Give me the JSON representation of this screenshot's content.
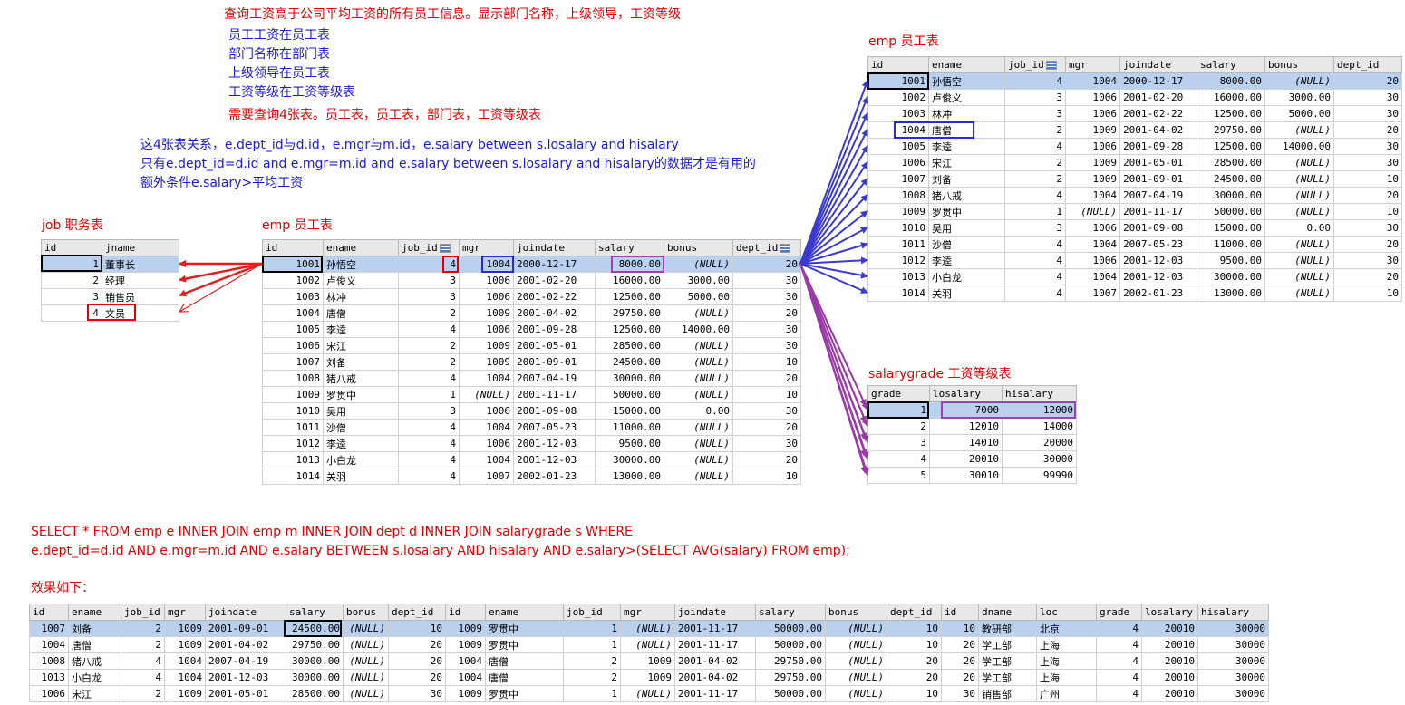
{
  "notes": {
    "line1": "查询工资高于公司平均工资的所有员工信息。显示部门名称，上级领导，工资等级",
    "line2": "员工工资在员工表",
    "line3": "部门名称在部门表",
    "line4": "上级领导在员工表",
    "line5": "工资等级在工资等级表",
    "line6": "需要查询4张表。员工表，员工表，部门表，工资等级表",
    "line7": "这4张表关系，e.dept_id与d.id，e.mgr与m.id，e.salary between s.losalary and hisalary",
    "line8": "只有e.dept_id=d.id and e.mgr=m.id and e.salary between s.losalary and hisalary的数据才是有用的",
    "line9": "额外条件e.salary>平均工资"
  },
  "titles": {
    "job": "job 职务表",
    "emp_mid": "emp 员工表",
    "emp_right": "emp 员工表",
    "salarygrade": "salarygrade 工资等级表",
    "result": "效果如下："
  },
  "sql": {
    "line1": "SELECT * FROM emp e INNER JOIN emp m INNER JOIN dept d INNER JOIN salarygrade s WHERE",
    "line2": "e.dept_id=d.id AND e.mgr=m.id AND e.salary BETWEEN s.losalary AND hisalary AND e.salary>(SELECT AVG(salary) FROM emp);"
  },
  "job_table": {
    "headers": [
      "id",
      "jname"
    ],
    "rows": [
      [
        "1",
        "董事长"
      ],
      [
        "2",
        "经理"
      ],
      [
        "3",
        "销售员"
      ],
      [
        "4",
        "文员"
      ]
    ]
  },
  "emp_table": {
    "headers": [
      "id",
      "ename",
      "job_id",
      "mgr",
      "joindate",
      "salary",
      "bonus",
      "dept_id"
    ],
    "rows": [
      [
        "1001",
        "孙悟空",
        "4",
        "1004",
        "2000-12-17",
        "8000.00",
        "(NULL)",
        "20"
      ],
      [
        "1002",
        "卢俊义",
        "3",
        "1006",
        "2001-02-20",
        "16000.00",
        "3000.00",
        "30"
      ],
      [
        "1003",
        "林冲",
        "3",
        "1006",
        "2001-02-22",
        "12500.00",
        "5000.00",
        "30"
      ],
      [
        "1004",
        "唐僧",
        "2",
        "1009",
        "2001-04-02",
        "29750.00",
        "(NULL)",
        "20"
      ],
      [
        "1005",
        "李逵",
        "4",
        "1006",
        "2001-09-28",
        "12500.00",
        "14000.00",
        "30"
      ],
      [
        "1006",
        "宋江",
        "2",
        "1009",
        "2001-05-01",
        "28500.00",
        "(NULL)",
        "30"
      ],
      [
        "1007",
        "刘备",
        "2",
        "1009",
        "2001-09-01",
        "24500.00",
        "(NULL)",
        "10"
      ],
      [
        "1008",
        "猪八戒",
        "4",
        "1004",
        "2007-04-19",
        "30000.00",
        "(NULL)",
        "20"
      ],
      [
        "1009",
        "罗贯中",
        "1",
        "(NULL)",
        "2001-11-17",
        "50000.00",
        "(NULL)",
        "10"
      ],
      [
        "1010",
        "吴用",
        "3",
        "1006",
        "2001-09-08",
        "15000.00",
        "0.00",
        "30"
      ],
      [
        "1011",
        "沙僧",
        "4",
        "1004",
        "2007-05-23",
        "11000.00",
        "(NULL)",
        "20"
      ],
      [
        "1012",
        "李逵",
        "4",
        "1006",
        "2001-12-03",
        "9500.00",
        "(NULL)",
        "30"
      ],
      [
        "1013",
        "小白龙",
        "4",
        "1004",
        "2001-12-03",
        "30000.00",
        "(NULL)",
        "20"
      ],
      [
        "1014",
        "关羽",
        "4",
        "1007",
        "2002-01-23",
        "13000.00",
        "(NULL)",
        "10"
      ]
    ]
  },
  "salarygrade_table": {
    "headers": [
      "grade",
      "losalary",
      "hisalary"
    ],
    "rows": [
      [
        "1",
        "7000",
        "12000"
      ],
      [
        "2",
        "12010",
        "14000"
      ],
      [
        "3",
        "14010",
        "20000"
      ],
      [
        "4",
        "20010",
        "30000"
      ],
      [
        "5",
        "30010",
        "99990"
      ]
    ]
  },
  "result_table": {
    "headers": [
      "id",
      "ename",
      "job_id",
      "mgr",
      "joindate",
      "salary",
      "bonus",
      "dept_id",
      "id",
      "ename",
      "job_id",
      "mgr",
      "joindate",
      "salary",
      "bonus",
      "dept_id",
      "id",
      "dname",
      "loc",
      "grade",
      "losalary",
      "hisalary"
    ],
    "rows": [
      [
        "1007",
        "刘备",
        "2",
        "1009",
        "2001-09-01",
        "24500.00",
        "(NULL)",
        "10",
        "1009",
        "罗贯中",
        "1",
        "(NULL)",
        "2001-11-17",
        "50000.00",
        "(NULL)",
        "10",
        "10",
        "教研部",
        "北京",
        "4",
        "20010",
        "30000"
      ],
      [
        "1004",
        "唐僧",
        "2",
        "1009",
        "2001-04-02",
        "29750.00",
        "(NULL)",
        "20",
        "1009",
        "罗贯中",
        "1",
        "(NULL)",
        "2001-11-17",
        "50000.00",
        "(NULL)",
        "10",
        "20",
        "学工部",
        "上海",
        "4",
        "20010",
        "30000"
      ],
      [
        "1008",
        "猪八戒",
        "4",
        "1004",
        "2007-04-19",
        "30000.00",
        "(NULL)",
        "20",
        "1004",
        "唐僧",
        "2",
        "1009",
        "2001-04-02",
        "29750.00",
        "(NULL)",
        "20",
        "20",
        "学工部",
        "上海",
        "4",
        "20010",
        "30000"
      ],
      [
        "1013",
        "小白龙",
        "4",
        "1004",
        "2001-12-03",
        "30000.00",
        "(NULL)",
        "20",
        "1004",
        "唐僧",
        "2",
        "1009",
        "2001-04-02",
        "29750.00",
        "(NULL)",
        "20",
        "20",
        "学工部",
        "上海",
        "4",
        "20010",
        "30000"
      ],
      [
        "1006",
        "宋江",
        "2",
        "1009",
        "2001-05-01",
        "28500.00",
        "(NULL)",
        "30",
        "1009",
        "罗贯中",
        "1",
        "(NULL)",
        "2001-11-17",
        "50000.00",
        "(NULL)",
        "10",
        "30",
        "销售部",
        "广州",
        "4",
        "20010",
        "30000"
      ]
    ]
  },
  "colors": {
    "red_arrow": "#e02020",
    "blue_arrow": "#3a3ad0",
    "purple_arrow": "#9a3aa8",
    "selected_row": "#b9d1ee"
  }
}
